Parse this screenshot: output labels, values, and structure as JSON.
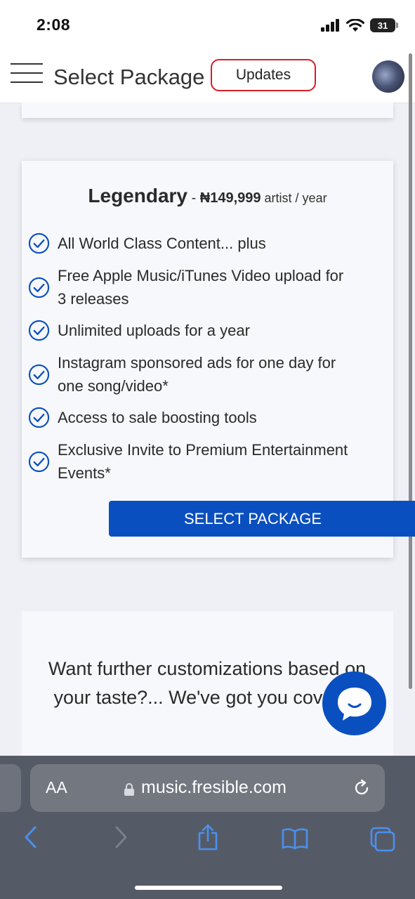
{
  "status_bar": {
    "time": "2:08",
    "battery": "31"
  },
  "header": {
    "title": "Select Package",
    "updates_label": "Updates"
  },
  "package": {
    "name": "Legendary",
    "separator": " - ",
    "price": "₦149,999",
    "unit": " artist / year",
    "features": [
      "All World Class Content... plus",
      "Free Apple Music/iTunes Video upload for 3 releases",
      "Unlimited uploads for a year",
      "Instagram sponsored ads for one day for one song/video*",
      "Access to sale boosting tools",
      "Exclusive Invite to Premium Entertainment Events*"
    ],
    "select_label": "SELECT PACKAGE"
  },
  "customization": {
    "text": "Want further customizations based on your taste?... We've got you covered"
  },
  "browser": {
    "aa_label": "AA",
    "url": "music.fresible.com"
  },
  "colors": {
    "accent": "#0a4fbf",
    "updates_border": "#d61f26",
    "page_bg": "#eef0f6"
  },
  "icons": {
    "menu": "hamburger-icon",
    "check": "check-circle-icon",
    "chat": "chat-icon",
    "lock": "lock-icon",
    "reload": "reload-icon",
    "back": "back-arrow-icon",
    "forward": "forward-arrow-icon",
    "share": "share-icon",
    "bookmarks": "bookmarks-icon",
    "tabs": "tabs-icon"
  }
}
